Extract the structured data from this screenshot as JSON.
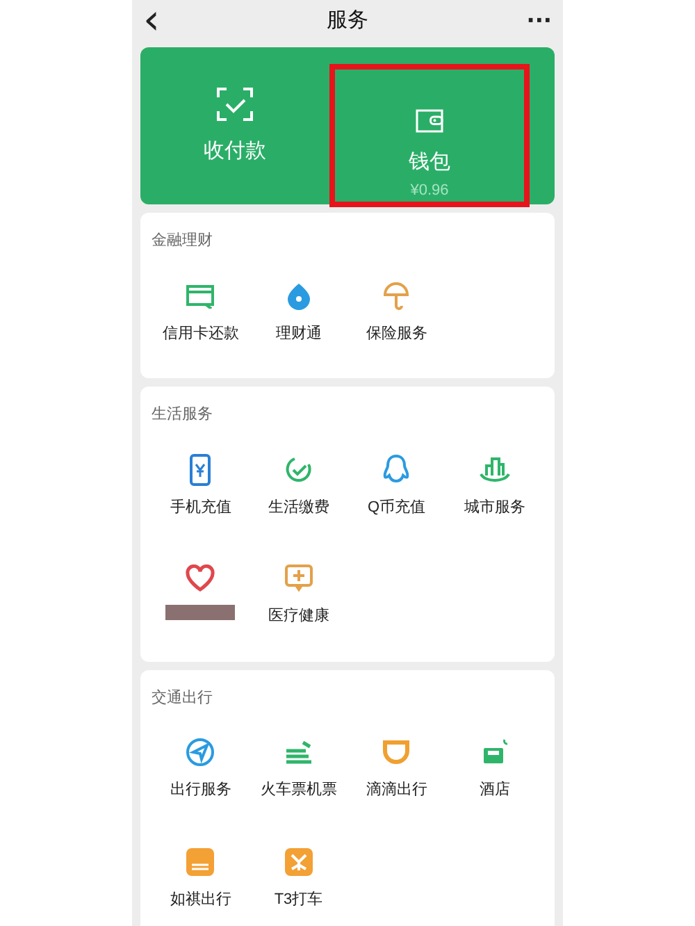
{
  "header": {
    "title": "服务",
    "back": "‹",
    "more": "···"
  },
  "top_card": [
    {
      "label": "收付款",
      "highlighted": false
    },
    {
      "label": "钱包",
      "sub": "¥0.96",
      "highlighted": true
    }
  ],
  "sections": [
    {
      "title": "金融理财",
      "items": [
        {
          "label": "信用卡还款"
        },
        {
          "label": "理财通"
        },
        {
          "label": "保险服务"
        }
      ]
    },
    {
      "title": "生活服务",
      "items": [
        {
          "label": "手机充值"
        },
        {
          "label": "生活缴费"
        },
        {
          "label": "Q币充值"
        },
        {
          "label": "城市服务"
        },
        {
          "kind": "redacted"
        },
        {
          "label": "医疗健康"
        }
      ]
    },
    {
      "title": "交通出行",
      "items": [
        {
          "label": "出行服务"
        },
        {
          "label": "火车票机票"
        },
        {
          "label": "滴滴出行"
        },
        {
          "label": "酒店"
        },
        {
          "label": "如祺出行"
        },
        {
          "label": "T3打车"
        }
      ]
    }
  ]
}
